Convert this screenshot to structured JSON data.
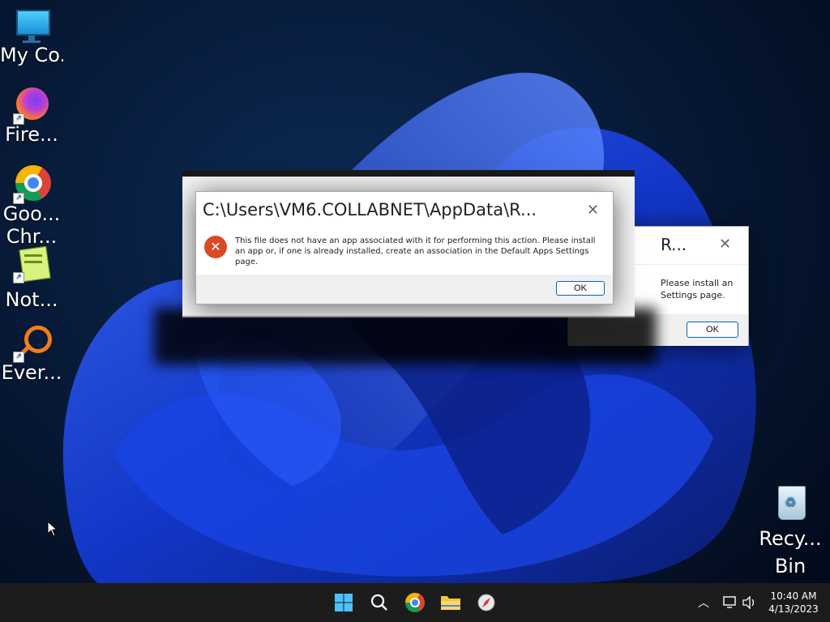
{
  "desktop": {
    "icons": [
      {
        "label": "My Co...",
        "icon": "computer-icon"
      },
      {
        "label": "Fire...",
        "icon": "firefox-icon"
      },
      {
        "label": "Goo... Chr...",
        "icon": "chrome-icon"
      },
      {
        "label": "Not...",
        "icon": "notepad-plus-plus-icon"
      },
      {
        "label": "Ever...",
        "icon": "everything-search-icon"
      },
      {
        "label": "Recy... Bin",
        "icon": "recycle-bin-icon"
      }
    ]
  },
  "dialogs": {
    "front": {
      "title": "C:\\Users\\VM6.COLLABNET\\AppData\\R...",
      "message": "This file does not have an app associated with it for performing this action. Please install an app or, if one is already installed, create an association in the Default Apps Settings page.",
      "ok_label": "OK"
    },
    "back": {
      "title": "R...",
      "message_line1": "Please install an",
      "message_line2": "Settings page.",
      "ok_label": "OK"
    }
  },
  "taskbar": {
    "time": "10:40 AM",
    "date": "4/13/2023",
    "pinned": [
      "start-icon",
      "search-icon",
      "chrome-icon",
      "file-explorer-icon",
      "compass-app-icon"
    ]
  },
  "colors": {
    "accent": "#0067c0",
    "error": "#d94a25",
    "taskbar": "#1c1c1c"
  }
}
